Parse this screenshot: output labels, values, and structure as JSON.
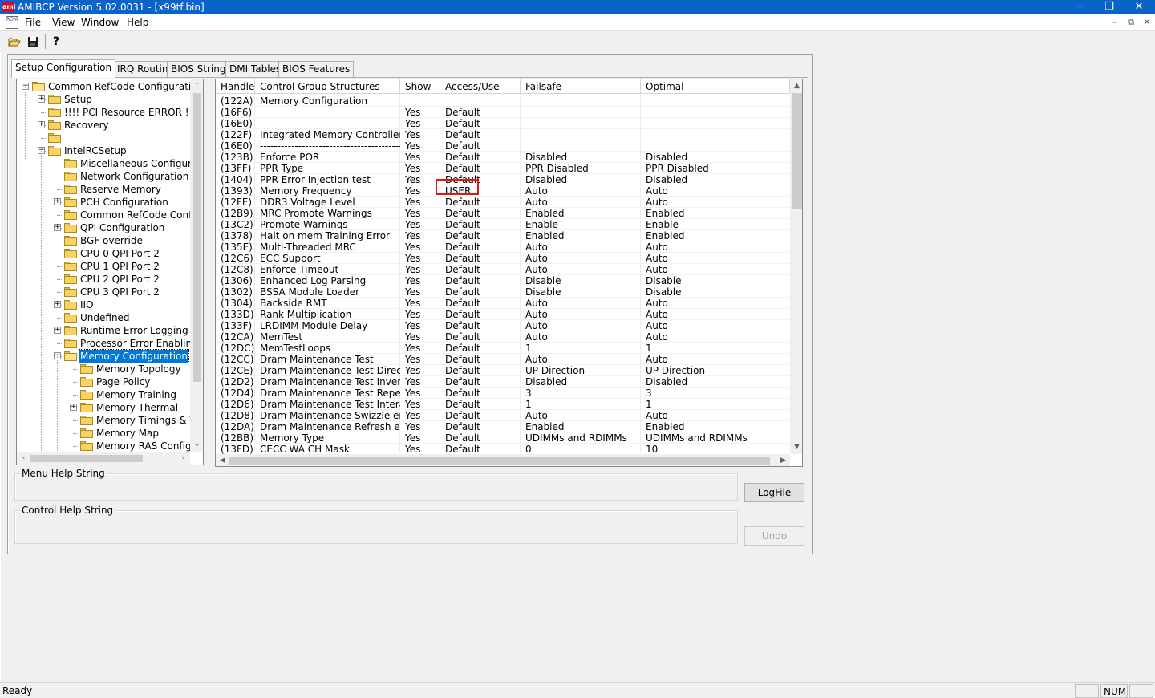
{
  "window": {
    "title": "AMIBCP Version 5.02.0031 - [x99tf.bin]",
    "icon_text": "ami",
    "controls": {
      "minimize": "─",
      "restore": "❐",
      "close": "✕"
    }
  },
  "menubar": {
    "items": [
      "File",
      "View",
      "Window",
      "Help"
    ],
    "mdi_icon_text": "ROM",
    "mdi_controls": {
      "minimize": "–",
      "restore": "⧉",
      "close": "✕"
    }
  },
  "toolbar": {
    "open_icon": "folder-open-icon",
    "save_icon": "save-icon",
    "help_icon": "help-icon",
    "help_glyph": "?"
  },
  "tabs": [
    "Setup Configuration",
    "PCI IRQ Routing",
    "BIOS Strings",
    "DMI Tables",
    "BIOS Features"
  ],
  "active_tab": 0,
  "tree": {
    "items": [
      {
        "label": "Common RefCode Configuration",
        "level": 0,
        "expander": "−",
        "open": true
      },
      {
        "label": "Setup",
        "level": 1,
        "expander": "+"
      },
      {
        "label": "!!!! PCI Resource ERROR !!!!",
        "level": 1,
        "expander": ""
      },
      {
        "label": "Recovery",
        "level": 1,
        "expander": "+"
      },
      {
        "label": "",
        "level": 1,
        "expander": ""
      },
      {
        "label": "IntelRCSetup",
        "level": 1,
        "expander": "−"
      },
      {
        "label": "Miscellaneous Configuration",
        "level": 2,
        "expander": ""
      },
      {
        "label": "Network Configuration",
        "level": 2,
        "expander": ""
      },
      {
        "label": "Reserve Memory",
        "level": 2,
        "expander": ""
      },
      {
        "label": "PCH Configuration",
        "level": 2,
        "expander": "+"
      },
      {
        "label": "Common RefCode Configuratio",
        "level": 2,
        "expander": ""
      },
      {
        "label": "QPI Configuration",
        "level": 2,
        "expander": "+"
      },
      {
        "label": "BGF override",
        "level": 2,
        "expander": ""
      },
      {
        "label": "CPU 0 QPI Port 2",
        "level": 2,
        "expander": ""
      },
      {
        "label": "CPU 1 QPI Port 2",
        "level": 2,
        "expander": ""
      },
      {
        "label": "CPU 2 QPI Port 2",
        "level": 2,
        "expander": ""
      },
      {
        "label": "CPU 3 QPI Port 2",
        "level": 2,
        "expander": ""
      },
      {
        "label": "IIO",
        "level": 2,
        "expander": "+"
      },
      {
        "label": "Undefined",
        "level": 2,
        "expander": ""
      },
      {
        "label": "Runtime Error Logging",
        "level": 2,
        "expander": "+"
      },
      {
        "label": "Processor Error Enabling :",
        "level": 2,
        "expander": ""
      },
      {
        "label": "Memory Configuration",
        "level": 2,
        "expander": "−",
        "selected": true,
        "open": true
      },
      {
        "label": "Memory Topology",
        "level": 3,
        "expander": ""
      },
      {
        "label": "Page Policy",
        "level": 3,
        "expander": ""
      },
      {
        "label": "Memory Training",
        "level": 3,
        "expander": ""
      },
      {
        "label": "Memory Thermal",
        "level": 3,
        "expander": "+"
      },
      {
        "label": "Memory Timings & Voltage",
        "level": 3,
        "expander": ""
      },
      {
        "label": "Memory Map",
        "level": 3,
        "expander": ""
      },
      {
        "label": "Memory RAS Configuratio",
        "level": 3,
        "expander": ""
      }
    ]
  },
  "grid": {
    "columns": [
      "Handle",
      "Control Group Structures",
      "Show",
      "Access/Use",
      "Failsafe",
      "Optimal"
    ],
    "highlight_row": 8,
    "rows": [
      [
        "(122A)",
        "Memory Configuration",
        "",
        "",
        "",
        ""
      ],
      [
        "(16F6)",
        "",
        "Yes",
        "Default",
        "",
        ""
      ],
      [
        "(16E0)",
        "--------------------------------------------------",
        "Yes",
        "Default",
        "",
        ""
      ],
      [
        "(122F)",
        "Integrated Memory Controller (iMC)",
        "Yes",
        "Default",
        "",
        ""
      ],
      [
        "(16E0)",
        "--------------------------------------------------",
        "Yes",
        "Default",
        "",
        ""
      ],
      [
        "(123B)",
        "Enforce POR",
        "Yes",
        "Default",
        "Disabled",
        "Disabled"
      ],
      [
        "(13FF)",
        "PPR Type",
        "Yes",
        "Default",
        "PPR Disabled",
        "PPR Disabled"
      ],
      [
        "(1404)",
        "PPR Error Injection test",
        "Yes",
        "Default",
        "Disabled",
        "Disabled"
      ],
      [
        "(1393)",
        "Memory Frequency",
        "Yes",
        "USER",
        "Auto",
        "Auto"
      ],
      [
        "(12FE)",
        "DDR3 Voltage Level",
        "Yes",
        "Default",
        "Auto",
        "Auto"
      ],
      [
        "(12B9)",
        "MRC Promote Warnings",
        "Yes",
        "Default",
        "Enabled",
        "Enabled"
      ],
      [
        "(13C2)",
        "Promote Warnings",
        "Yes",
        "Default",
        "Enable",
        "Enable"
      ],
      [
        "(1378)",
        "Halt on mem Training Error",
        "Yes",
        "Default",
        "Enabled",
        "Enabled"
      ],
      [
        "(135E)",
        "Multi-Threaded MRC",
        "Yes",
        "Default",
        "Auto",
        "Auto"
      ],
      [
        "(12C6)",
        "ECC Support",
        "Yes",
        "Default",
        "Auto",
        "Auto"
      ],
      [
        "(12C8)",
        "Enforce Timeout",
        "Yes",
        "Default",
        "Auto",
        "Auto"
      ],
      [
        "(1306)",
        "Enhanced Log Parsing",
        "Yes",
        "Default",
        "Disable",
        "Disable"
      ],
      [
        "(1302)",
        "BSSA Module Loader",
        "Yes",
        "Default",
        "Disable",
        "Disable"
      ],
      [
        "(1304)",
        "Backside RMT",
        "Yes",
        "Default",
        "Auto",
        "Auto"
      ],
      [
        "(133D)",
        "Rank Multiplication",
        "Yes",
        "Default",
        "Auto",
        "Auto"
      ],
      [
        "(133F)",
        "LRDIMM Module Delay",
        "Yes",
        "Default",
        "Auto",
        "Auto"
      ],
      [
        "(12CA)",
        "MemTest",
        "Yes",
        "Default",
        "Auto",
        "Auto"
      ],
      [
        "(12DC)",
        "MemTestLoops",
        "Yes",
        "Default",
        "1",
        "1"
      ],
      [
        "(12CC)",
        "Dram Maintenance Test",
        "Yes",
        "Default",
        "Auto",
        "Auto"
      ],
      [
        "(12CE)",
        "Dram Maintenance Test Direction",
        "Yes",
        "Default",
        "UP Direction",
        "UP Direction"
      ],
      [
        "(12D2)",
        "Dram Maintenance Test Invertion",
        "Yes",
        "Default",
        "Disabled",
        "Disabled"
      ],
      [
        "(12D4)",
        "Dram Maintenance Test Repetitio...",
        "Yes",
        "Default",
        "3",
        "3"
      ],
      [
        "(12D6)",
        "Dram Maintenance Test Interatio...",
        "Yes",
        "Default",
        "1",
        "1"
      ],
      [
        "(12D8)",
        "Dram Maintenance Swizzle enabli...",
        "Yes",
        "Default",
        "Auto",
        "Auto"
      ],
      [
        "(12DA)",
        "Dram Maintenance Refresh enabl...",
        "Yes",
        "Default",
        "Enabled",
        "Enabled"
      ],
      [
        "(12BB)",
        "Memory Type",
        "Yes",
        "Default",
        "UDIMMs and RDIMMs",
        "UDIMMs and RDIMMs"
      ],
      [
        "(13FD)",
        "CECC WA CH Mask",
        "Yes",
        "Default",
        "0",
        "10"
      ]
    ]
  },
  "help": {
    "menu_help_title": "Menu Help String",
    "control_help_title": "Control Help String",
    "logfile_label": "LogFile",
    "undo_label": "Undo"
  },
  "status": {
    "text": "Ready",
    "indicator": "NUM"
  },
  "scroll": {
    "up": "▲",
    "down": "▼",
    "left": "◀",
    "right": "▶",
    "tree_up": "⌃",
    "tree_down": "⌄",
    "tree_left": "‹",
    "tree_right": "›"
  }
}
